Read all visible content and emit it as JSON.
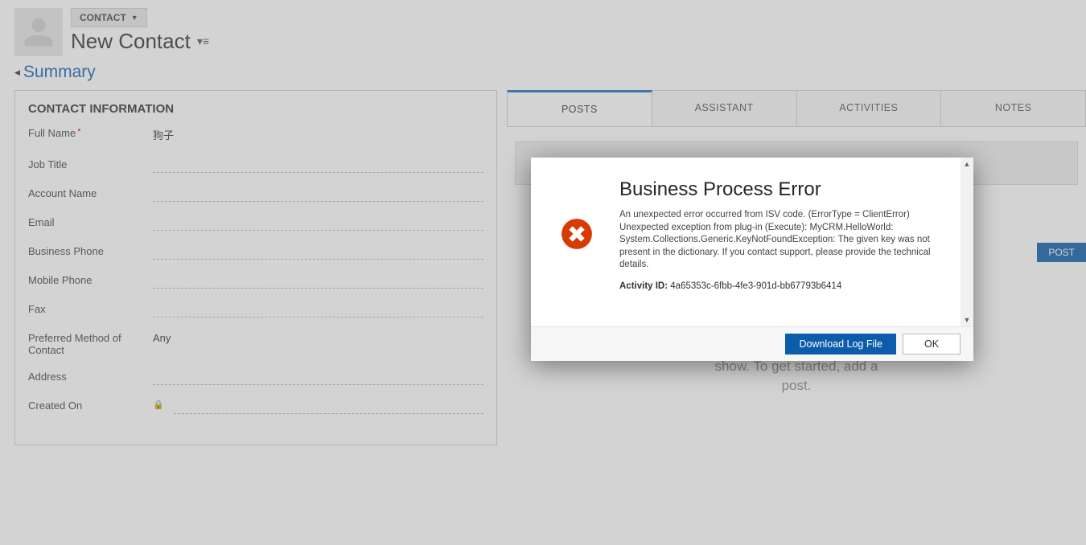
{
  "header": {
    "entity_label": "CONTACT",
    "record_title": "New Contact"
  },
  "section": {
    "title": "Summary"
  },
  "contact_card": {
    "title": "CONTACT INFORMATION",
    "fields": {
      "full_name_label": "Full Name",
      "full_name_value": "狗子",
      "job_title_label": "Job Title",
      "account_name_label": "Account Name",
      "email_label": "Email",
      "business_phone_label": "Business Phone",
      "mobile_phone_label": "Mobile Phone",
      "fax_label": "Fax",
      "preferred_method_label": "Preferred Method of Contact",
      "preferred_method_value": "Any",
      "address_label": "Address",
      "created_on_label": "Created On"
    }
  },
  "tabs": {
    "posts": "POSTS",
    "assistant": "ASSISTANT",
    "activities": "ACTIVITIES",
    "notes": "NOTES"
  },
  "posts_panel": {
    "post_button": "POST",
    "empty_message": "There aren't any posts to show. To get started, add a post."
  },
  "error_dialog": {
    "title": "Business Process Error",
    "message": "An unexpected error occurred from ISV code. (ErrorType = ClientError) Unexpected exception from plug-in (Execute): MyCRM.HelloWorld: System.Collections.Generic.KeyNotFoundException: The given key was not present in the dictionary. If you contact support, please provide the technical details.",
    "activity_label": "Activity ID:",
    "activity_id": "4a65353c-6fbb-4fe3-901d-bb67793b6414",
    "download_button": "Download Log File",
    "ok_button": "OK"
  }
}
